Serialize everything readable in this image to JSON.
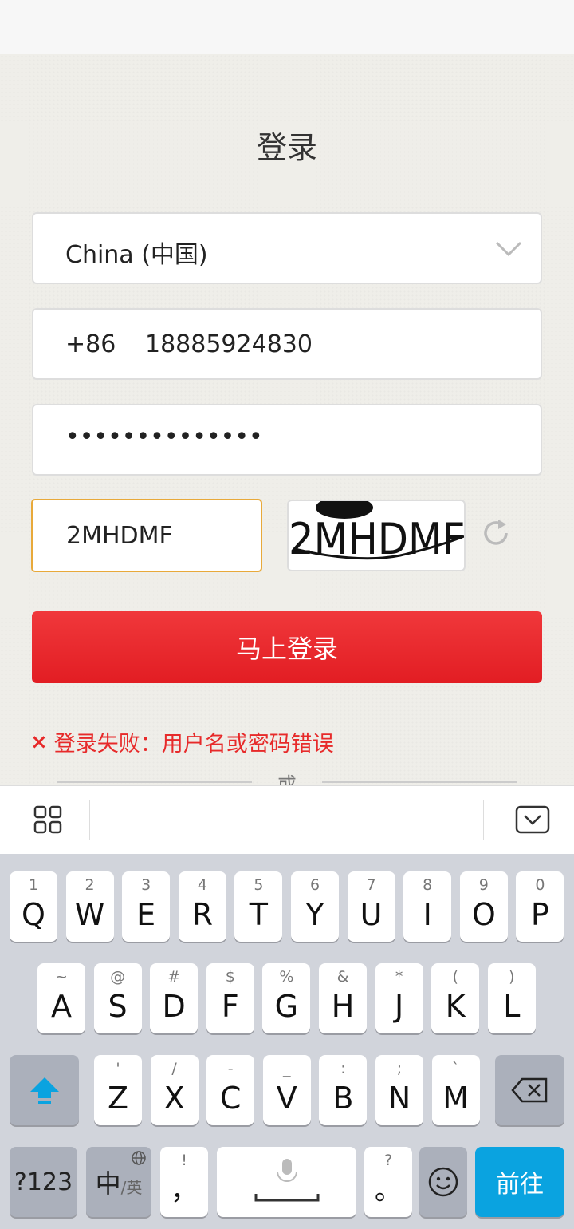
{
  "page": {
    "title": "登录",
    "country_select": {
      "value": "China (中国)"
    },
    "phone": {
      "country_code": "+86",
      "number": "18885924830"
    },
    "password": {
      "masked_value": "••••••••••••••"
    },
    "captcha": {
      "input_value": "2MHDMF",
      "image_text": "2MHDMF"
    },
    "login_button": "马上登录",
    "error_message": "登录失败：用户名或密码错误",
    "error_icon": "×",
    "divider_text": "或"
  },
  "keyboard": {
    "row1": [
      {
        "k": "Q",
        "h": "1"
      },
      {
        "k": "W",
        "h": "2"
      },
      {
        "k": "E",
        "h": "3"
      },
      {
        "k": "R",
        "h": "4"
      },
      {
        "k": "T",
        "h": "5"
      },
      {
        "k": "Y",
        "h": "6"
      },
      {
        "k": "U",
        "h": "7"
      },
      {
        "k": "I",
        "h": "8"
      },
      {
        "k": "O",
        "h": "9"
      },
      {
        "k": "P",
        "h": "0"
      }
    ],
    "row2": [
      {
        "k": "A",
        "h": "~"
      },
      {
        "k": "S",
        "h": "@"
      },
      {
        "k": "D",
        "h": "#"
      },
      {
        "k": "F",
        "h": "$"
      },
      {
        "k": "G",
        "h": "%"
      },
      {
        "k": "H",
        "h": "&"
      },
      {
        "k": "J",
        "h": "*"
      },
      {
        "k": "K",
        "h": "("
      },
      {
        "k": "L",
        "h": ")"
      }
    ],
    "row3": [
      {
        "k": "Z",
        "h": "'"
      },
      {
        "k": "X",
        "h": "/"
      },
      {
        "k": "C",
        "h": "-"
      },
      {
        "k": "V",
        "h": "_"
      },
      {
        "k": "B",
        "h": ":"
      },
      {
        "k": "N",
        "h": ";"
      },
      {
        "k": "M",
        "h": "`"
      }
    ],
    "symbols_key": "?123",
    "lang_key_main": "中",
    "lang_key_sub": "/英",
    "comma_key": {
      "k": "，",
      "h": "!"
    },
    "period_key": {
      "k": "。",
      "h": "?"
    },
    "go_key": "前往",
    "icons": [
      "shift-icon",
      "backspace-icon",
      "globe-icon",
      "mic-icon",
      "emoji-icon",
      "grid-icon",
      "keyboard-hide-icon"
    ]
  },
  "colors": {
    "accent_red": "#e21d23",
    "focus_border": "#e8a93a",
    "go_blue": "#0aa3e0"
  }
}
